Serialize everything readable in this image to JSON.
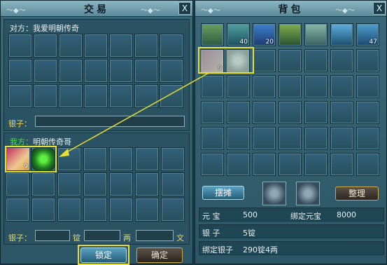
{
  "trade": {
    "title": "交易",
    "close_label": "X",
    "other_label": "对方：我爱明朝传奇",
    "other_silver_label": "银子：",
    "me_prefix": "我方：",
    "me_name": "明朝传奇哥",
    "me_silver_label": "银子：",
    "unit_ding": "锭",
    "unit_liang": "两",
    "unit_wen": "文",
    "lock_button": "锁定",
    "confirm_button": "确定",
    "my_items": [
      {
        "icon": "scroll-ticket-icon",
        "count": "9"
      },
      {
        "icon": "green-gem-icon",
        "count": ""
      }
    ]
  },
  "bag": {
    "title": "背包",
    "close_label": "X",
    "top_items": [
      {
        "icon": "green-pouch-icon",
        "count": ""
      },
      {
        "icon": "green-potion-icon",
        "count": "40"
      },
      {
        "icon": "blue-potion-icon",
        "count": "20"
      },
      {
        "icon": "green-bottle-icon",
        "count": ""
      },
      {
        "icon": "bracelet-icon",
        "count": ""
      },
      {
        "icon": "blue-scroll-icon",
        "count": ""
      },
      {
        "icon": "blue-book-icon",
        "count": "47"
      }
    ],
    "faded_items": [
      {
        "icon": "scroll-ticket-icon",
        "count": "9"
      },
      {
        "icon": "green-gem-icon",
        "count": ""
      }
    ],
    "stall_button": "摆摊",
    "sort_button": "整理",
    "stats": {
      "yuanbao_label": "元  宝",
      "yuanbao_value": "500",
      "bound_yuanbao_label": "绑定元宝",
      "bound_yuanbao_value": "8000",
      "silver_label": "银  子",
      "silver_value": "5锭",
      "bound_silver_label": "绑定银子",
      "bound_silver_value": "290锭4两"
    }
  }
}
